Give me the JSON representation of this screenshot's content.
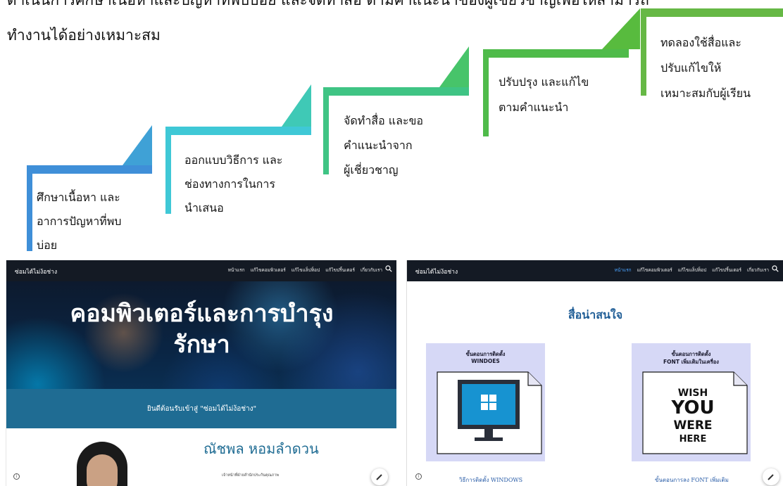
{
  "intro": {
    "line1": "ดำเนินการศึกษาเนื้อหาและปัญหาที่พบบ่อย และจัดทำสื่อ ตามคำแนะนำของผู้เชี่ยวชาญเพื่อให้สามารถ",
    "line2": "ทำงานได้อย่างเหมาะสม"
  },
  "steps": [
    {
      "lines": [
        "ศึกษาเนื้อหา และ",
        "อาการปัญหาที่พบ",
        "บ่อย"
      ],
      "color": "#3f8fd8"
    },
    {
      "lines": [
        "ออกแบบวิธีการ และ",
        "ช่องทางการในการ",
        "นำเสนอ"
      ],
      "color": "#3fc8d6"
    },
    {
      "lines": [
        "จัดทำสื่อ และขอ",
        "คำแนะนำจาก",
        "ผู้เชี่ยวชาญ"
      ],
      "color": "#3fc484"
    },
    {
      "lines": [
        "ปรับปรุง และแก้ไข",
        "ตามคำแนะนำ"
      ],
      "color": "#4fbb4a"
    },
    {
      "lines": [
        "ทดลองใช้สื่อและ",
        "ปรับแก้ไขให้",
        "เหมาะสมกับผู้เรียน"
      ],
      "color": "#66b845"
    }
  ],
  "left_site": {
    "brand": "ซ่อมได้ไม่ง้อช่าง",
    "nav": [
      "หน้าแรก",
      "แก้ไขคอมพิวเตอร์",
      "แก้ไขแล็ปท็อป",
      "แก้ไขปริ้นเตอร์",
      "เกี่ยวกับเรา"
    ],
    "hero_line1": "คอมพิวเตอร์และการบำรุง",
    "hero_line2": "รักษา",
    "welcome": "ยินดีต้อนรับเข้าสู่ \"ซ่อมได้ไม่ง้อช่าง\"",
    "profile_name": "ณัชพล หอมลำดวน",
    "profile_role": "เจ้าหน้าที่ฝ่ายสำนักประกันคุณภาพ",
    "info_icon": "i"
  },
  "right_site": {
    "brand": "ซ่อมได้ไม่ง้อช่าง",
    "nav": [
      "หน้าแรก",
      "แก้ไขคอมพิวเตอร์",
      "แก้ไขแล็ปท็อป",
      "แก้ไขปริ้นเตอร์",
      "เกี่ยวกับเรา"
    ],
    "section_title": "สื่อน่าสนใจ",
    "cards": [
      {
        "caption1": "ขั้นตอนการติดตั้ง",
        "caption2": "WINDOES",
        "link": "วิธีการติดตั้ง WINDOWS"
      },
      {
        "caption1": "ขั้นตอนการติดตั้ง",
        "caption2": "FONT เพิ่มเติมในเครื่อง",
        "link": "ขั้นตอนการลง FONT เพิ่มเติม"
      }
    ],
    "font_art": [
      "WISH",
      "YOU",
      "WERE",
      "HERE"
    ],
    "info_icon": "i"
  },
  "icons": {
    "search": "search-icon",
    "edit": "pencil-icon",
    "info": "info-icon",
    "windows": "windows-logo-icon"
  },
  "colors": {
    "nav_bg": "#141a24",
    "welcome_bar": "#1f6c93",
    "title_blue": "#1f6c93",
    "card_bg": "#d6d8f6",
    "nav_active": "#4aa3ff"
  }
}
